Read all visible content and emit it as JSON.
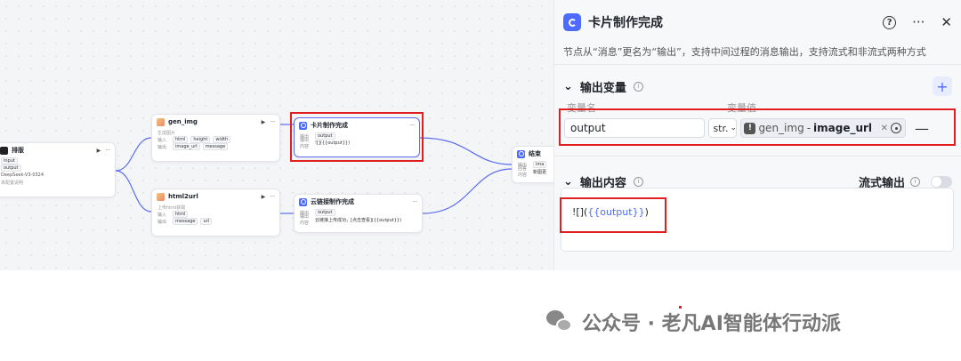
{
  "canvas": {
    "nodes": {
      "start": {
        "title": "排版",
        "rows": [
          "input",
          "output",
          "DeepSeek-V3-0324",
          "未配置说明"
        ]
      },
      "gen_img": {
        "title": "gen_img",
        "subtitle": "生成图片",
        "in_label": "输入",
        "in_tags": [
          "html",
          "height",
          "width"
        ],
        "out_label": "输出",
        "out_tags": [
          "image_url",
          "message"
        ]
      },
      "card": {
        "title": "卡片制作完成",
        "out_label": "输出",
        "out_tag": "output",
        "content_label": "输出内容",
        "content": "![]({{output}})"
      },
      "html2url": {
        "title": "html2url",
        "subtitle": "上传html获取",
        "in_label": "输入",
        "in_tags": [
          "html"
        ],
        "out_label": "输出",
        "out_tags": [
          "message",
          "url"
        ]
      },
      "cloud": {
        "title": "云链接制作完成",
        "out_label": "输出",
        "out_tag": "output",
        "content_label": "输出内容",
        "content": "云链接上传成功，[点击查看]({{output}})"
      },
      "end": {
        "title": "结束",
        "out_label": "输出",
        "out_tag": "ima",
        "content_label": "回答内容",
        "content": "新图更"
      }
    }
  },
  "panel": {
    "title": "卡片制作完成",
    "help_icon": "?",
    "more_icon": "···",
    "close_icon": "✕",
    "description": "节点从“消息”更名为“输出”，支持中间过程的消息输出，支持流式和非流式两种方式",
    "output_vars": {
      "section_title": "输出变量",
      "add_icon": "+",
      "col_name": "变量名",
      "col_value": "变量值",
      "row": {
        "name": "output",
        "type": "str.",
        "ref_node": "gen_img",
        "ref_sep": "-",
        "ref_field": "image_url"
      }
    },
    "output_content": {
      "section_title": "输出内容",
      "stream_label": "流式输出",
      "template_prefix": "![](",
      "template_var": "{{output}}",
      "template_suffix": ")"
    }
  },
  "watermark": {
    "text": "公众号 · 老凡AI智能体行动派"
  },
  "colors": {
    "accent": "#4d6bfe",
    "highlight": "#e02020"
  }
}
